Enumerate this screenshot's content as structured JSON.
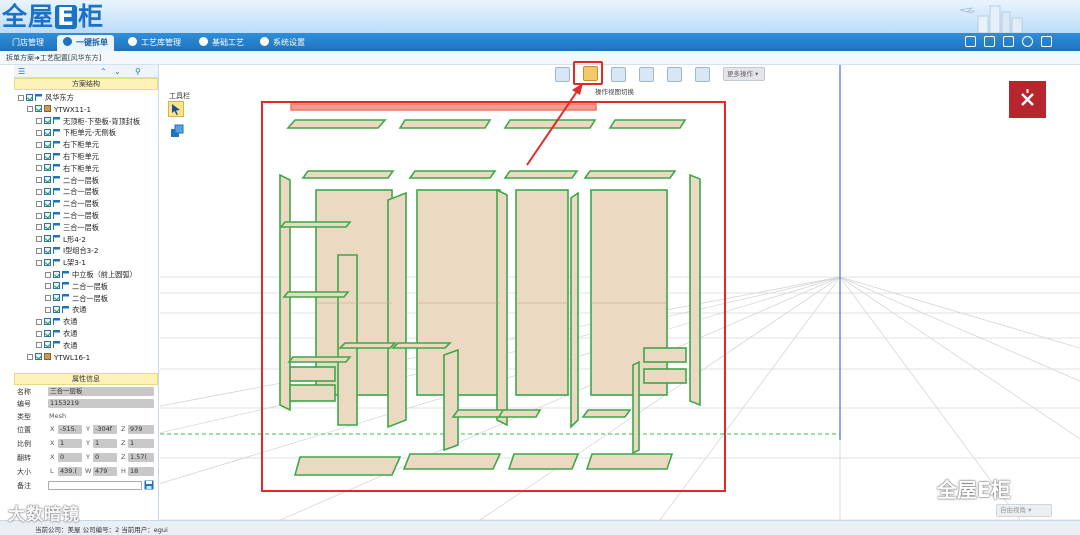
{
  "header": {
    "logo_text_a": "全屋",
    "logo_text_e": "E",
    "logo_text_b": "柜"
  },
  "nav": {
    "tabs": [
      {
        "label": "门店管理"
      },
      {
        "label": "一键拆单"
      },
      {
        "label": "工艺库管理"
      },
      {
        "label": "基础工艺"
      },
      {
        "label": "系统设置"
      }
    ]
  },
  "breadcrumb": {
    "text": "拆单方案➜工艺配置[风华东方]"
  },
  "leftpanel": {
    "tree_title": "方案结构",
    "tree": [
      {
        "label": "风华东方",
        "level": 0
      },
      {
        "label": "YTWX11-1",
        "level": 1
      },
      {
        "label": "无顶柜-下垫板-背顶封板",
        "level": 2
      },
      {
        "label": "下柜单元-无侧板",
        "level": 2
      },
      {
        "label": "右下柜单元",
        "level": 2
      },
      {
        "label": "右下柜单元",
        "level": 2
      },
      {
        "label": "右下柜单元",
        "level": 2
      },
      {
        "label": "二合一层板",
        "level": 2
      },
      {
        "label": "二合一层板",
        "level": 2
      },
      {
        "label": "二合一层板",
        "level": 2
      },
      {
        "label": "二合一层板",
        "level": 2
      },
      {
        "label": "三合一层板",
        "level": 2
      },
      {
        "label": "L形4-2",
        "level": 2
      },
      {
        "label": "I型组合3-2",
        "level": 2
      },
      {
        "label": "L架3-1",
        "level": 2
      },
      {
        "label": "中立板（前上圆弧）",
        "level": 3
      },
      {
        "label": "二合一层板",
        "level": 3
      },
      {
        "label": "二合一层板",
        "level": 3
      },
      {
        "label": "衣通",
        "level": 3
      },
      {
        "label": "衣通",
        "level": 2
      },
      {
        "label": "衣通",
        "level": 2
      },
      {
        "label": "衣通",
        "level": 2
      },
      {
        "label": "YTWL16-1",
        "level": 1
      }
    ],
    "props_title": "属性信息",
    "props": {
      "name_label": "名称",
      "name_value": "三合一层板",
      "code_label": "编号",
      "code_value": "1153219",
      "type_label": "类型",
      "type_value": "Mesh",
      "pos_label": "位置",
      "pos_x": "-515.",
      "pos_y": "-304f",
      "pos_z": "979",
      "scale_label": "比例",
      "scale_x": "1",
      "scale_y": "1",
      "scale_z": "1",
      "rot_label": "翻转",
      "rot_x": "0",
      "rot_y": "0",
      "rot_z": "1.57(",
      "size_label": "大小",
      "size_l": "439.(",
      "size_w": "479",
      "size_h": "18",
      "note_label": "备注",
      "axis_x": "X",
      "axis_y": "Y",
      "axis_z": "Z",
      "axis_l": "L",
      "axis_w": "W",
      "axis_h": "H"
    }
  },
  "viewport": {
    "tool_label": "工具栏",
    "switch_label": "操作视图切换",
    "more_label": "更多操作",
    "freeview_label": "自由视角"
  },
  "status": {
    "text": "当前公司：美屋    公司编号：2    当前用户：egui"
  },
  "watermarks": {
    "left": "大数暗镜",
    "right": "全屋E柜"
  },
  "colors": {
    "nav_blue": "#1f72bd",
    "highlight_red": "#e02a2a",
    "panel_fill": "#ecd9c2",
    "edge_green": "#3ea74a"
  }
}
